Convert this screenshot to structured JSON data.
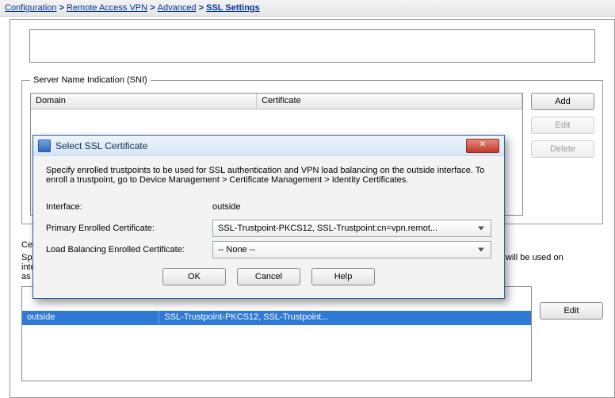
{
  "breadcrumb": {
    "parts": [
      "Configuration",
      "Remote Access VPN",
      "Advanced"
    ],
    "current": "SSL Settings"
  },
  "sni": {
    "legend": "Server Name Indication (SNI)",
    "cols": {
      "domain": "Domain",
      "certificate": "Certificate"
    },
    "buttons": {
      "add": "Add",
      "edit": "Edit",
      "delete": "Delete"
    }
  },
  "cert": {
    "section_label": "Certi",
    "desc_prefix": "Sp",
    "desc_suffix_line1": "ficate will be used on interfaces not",
    "desc_line2": "as",
    "edit": "Edit",
    "row": {
      "iface": "outside",
      "value": "SSL-Trustpoint-PKCS12, SSL-Trustpoint..."
    }
  },
  "dialog": {
    "title": "Select SSL Certificate",
    "close_glyph": "✕",
    "desc": "Specify enrolled trustpoints to be used for SSL authentication and VPN load balancing on the outside interface. To enroll a trustpoint, go to Device Management > Certificate Management > Identity Certificates.",
    "rows": {
      "interface": {
        "label": "Interface:",
        "value": "outside"
      },
      "primary": {
        "label": "Primary Enrolled Certificate:",
        "value": "SSL-Trustpoint-PKCS12, SSL-Trustpoint:cn=vpn.remot..."
      },
      "lb": {
        "label": "Load Balancing Enrolled Certificate:",
        "value": "-- None --"
      }
    },
    "buttons": {
      "ok": "OK",
      "cancel": "Cancel",
      "help": "Help"
    }
  }
}
